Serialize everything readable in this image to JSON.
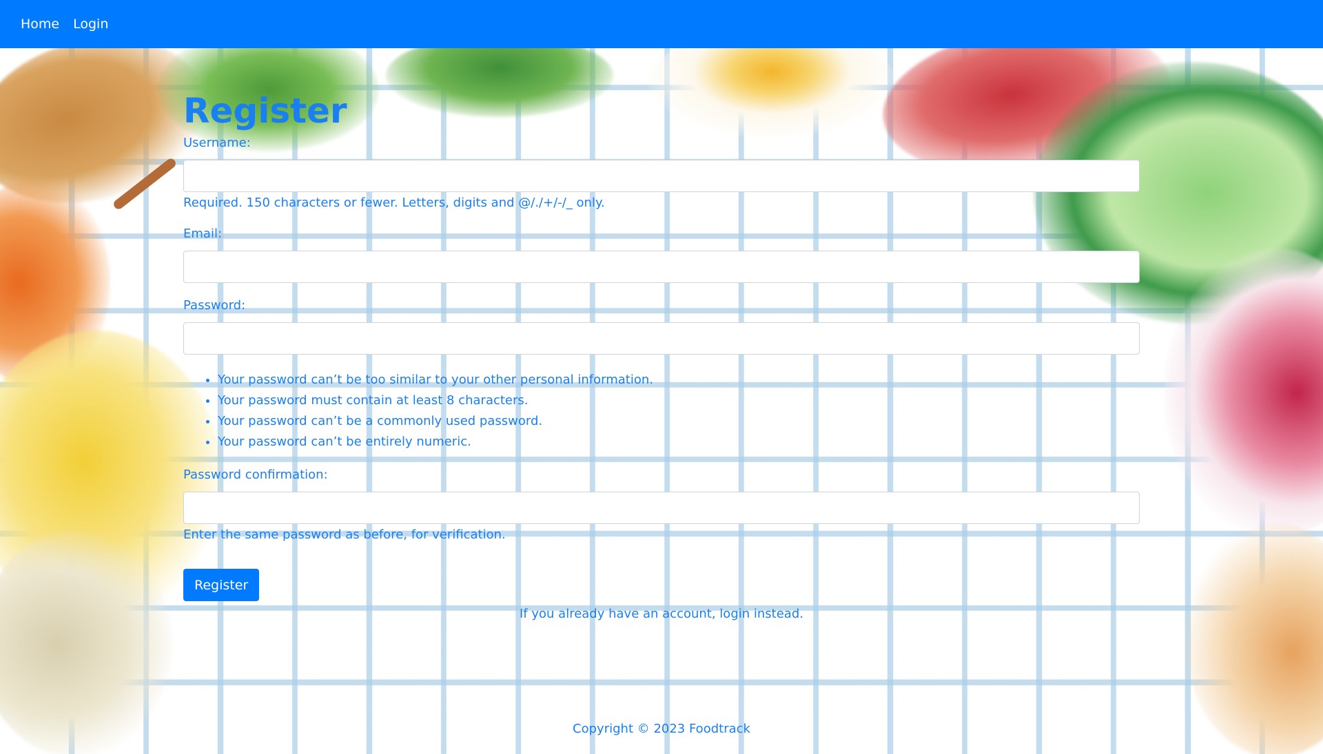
{
  "navbar": {
    "links": [
      {
        "label": "Home"
      },
      {
        "label": "Login"
      }
    ]
  },
  "page": {
    "title": "Register"
  },
  "form": {
    "username": {
      "label": "Username:",
      "value": "",
      "help": "Required. 150 characters or fewer. Letters, digits and @/./+/-/_ only."
    },
    "email": {
      "label": "Email:",
      "value": ""
    },
    "password": {
      "label": "Password:",
      "value": "",
      "rules": [
        "Your password can’t be too similar to your other personal information.",
        "Your password must contain at least 8 characters.",
        "Your password can’t be a commonly used password.",
        "Your password can’t be entirely numeric."
      ]
    },
    "password_confirmation": {
      "label": "Password confirmation:",
      "value": "",
      "help": "Enter the same password as before, for verification."
    },
    "submit_label": "Register",
    "login_hint": "If you already have an account, login instead."
  },
  "footer": {
    "text": "Copyright © 2023 Foodtrack"
  },
  "colors": {
    "accent": "#007bff",
    "text": "#1a7ff0"
  }
}
